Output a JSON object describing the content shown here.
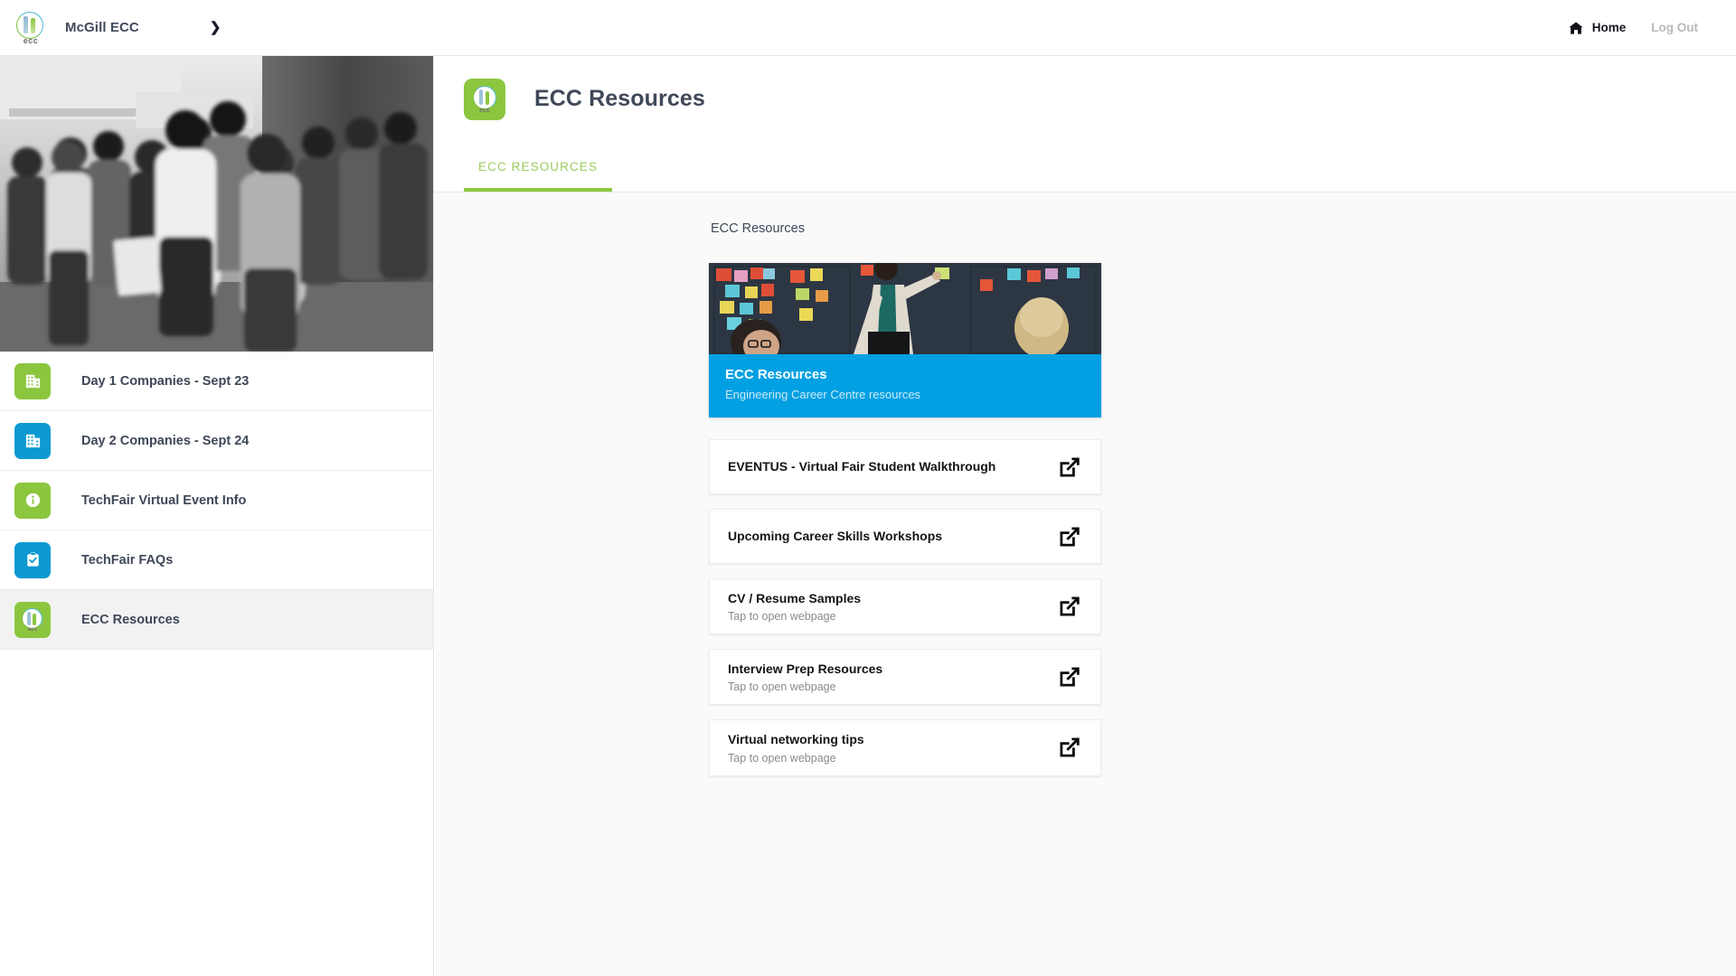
{
  "topbar": {
    "logo_icon": "ecc-circle-logo",
    "brand_name": "McGill ECC",
    "chevron_icon": "chevron-right-icon",
    "nav": [
      {
        "label": "Home",
        "icon": "home-icon",
        "muted": false
      },
      {
        "label": "Log Out",
        "icon": "",
        "muted": true
      }
    ]
  },
  "sidebar": {
    "hero_image_alt": "black and white photo of students at career fair",
    "items": [
      {
        "label": "Day 1 Companies - Sept 23",
        "icon": "building-icon",
        "color": "#8cc63f",
        "active": false
      },
      {
        "label": "Day 2 Companies - Sept 24",
        "icon": "building-icon",
        "color": "#0c9ad1",
        "active": false
      },
      {
        "label": "TechFair Virtual Event Info",
        "icon": "info-icon",
        "color": "#8cc63f",
        "active": false
      },
      {
        "label": "TechFair FAQs",
        "icon": "clipboard-check-icon",
        "color": "#0c9ad1",
        "active": false
      },
      {
        "label": "ECC Resources",
        "icon": "ecc-circle-logo",
        "color": "#8cc63f",
        "active": true
      }
    ]
  },
  "page": {
    "header_icon": "ecc-circle-logo",
    "title": "ECC Resources",
    "tabs": [
      {
        "label": "ECC RESOURCES",
        "active": true
      }
    ],
    "section_label": "ECC Resources",
    "hero_card": {
      "image_alt": "woman presenting at sticky note wall with two colleagues",
      "title": "ECC Resources",
      "subtitle": "Engineering Career Centre resources"
    },
    "links": [
      {
        "title": "EVENTUS - Virtual Fair Student Walkthrough",
        "subtitle": "",
        "icon": "open-in-new-icon"
      },
      {
        "title": "Upcoming Career Skills Workshops",
        "subtitle": "",
        "icon": "open-in-new-icon"
      },
      {
        "title": "CV / Resume Samples",
        "subtitle": "Tap to open webpage",
        "icon": "open-in-new-icon"
      },
      {
        "title": "Interview Prep Resources",
        "subtitle": "Tap to open webpage",
        "icon": "open-in-new-icon"
      },
      {
        "title": "Virtual networking tips",
        "subtitle": "Tap to open webpage",
        "icon": "open-in-new-icon"
      }
    ]
  },
  "colors": {
    "accent_green": "#8cc63f",
    "accent_blue": "#0c9ad1",
    "hero_blue": "#00a0e3",
    "text_dark": "#3f4858",
    "page_bg": "#fafafa"
  }
}
